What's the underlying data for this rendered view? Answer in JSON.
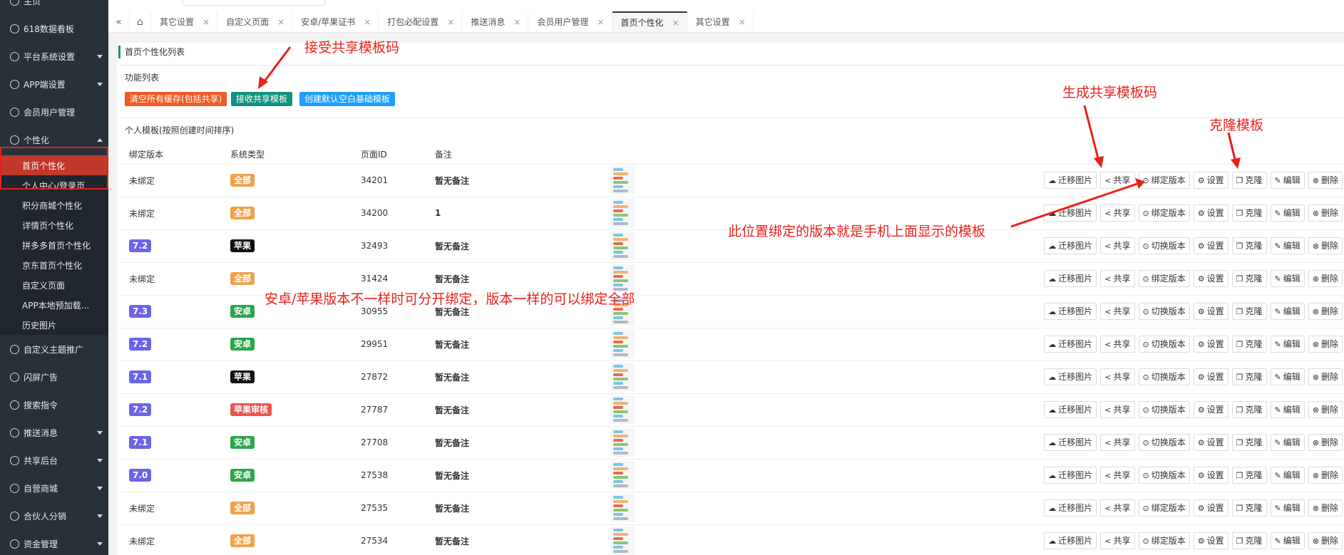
{
  "sidebar": {
    "items": [
      {
        "label": "主页",
        "icon": "home-icon"
      },
      {
        "label": "618数据看板",
        "icon": "dashboard-icon"
      },
      {
        "label": "平台系统设置",
        "icon": "settings-icon",
        "caret": true
      },
      {
        "label": "APP端设置",
        "icon": "gear-icon",
        "caret": true
      },
      {
        "label": "会员用户管理",
        "icon": "shield-icon"
      },
      {
        "label": "个性化",
        "icon": "palette-icon",
        "caret": "up"
      }
    ],
    "subitems": [
      {
        "label": "首页个性化",
        "active": true
      },
      {
        "label": "个人中心/登录页"
      },
      {
        "label": "积分商城个性化"
      },
      {
        "label": "详情页个性化"
      },
      {
        "label": "拼多多首页个性化"
      },
      {
        "label": "京东首页个性化"
      },
      {
        "label": "自定义页面"
      },
      {
        "label": "APP本地预加载..."
      },
      {
        "label": "历史图片"
      }
    ],
    "items2": [
      {
        "label": "自定义主题推广",
        "icon": "gear-icon"
      },
      {
        "label": "闪屏广告",
        "icon": "image-icon"
      },
      {
        "label": "搜索指令",
        "icon": "search-icon"
      },
      {
        "label": "推送消息",
        "icon": "user-icon",
        "caret": true
      },
      {
        "label": "共享后台",
        "icon": "user-icon",
        "caret": true
      },
      {
        "label": "自营商城",
        "icon": "shop-icon",
        "caret": true
      },
      {
        "label": "合伙人分销",
        "icon": "layers-icon",
        "caret": true
      },
      {
        "label": "资金管理",
        "icon": "link-icon",
        "caret": true
      }
    ]
  },
  "tabs": [
    {
      "label": "其它设置"
    },
    {
      "label": "自定义页面"
    },
    {
      "label": "安卓/苹果证书"
    },
    {
      "label": "打包必配设置"
    },
    {
      "label": "推送消息"
    },
    {
      "label": "会员用户管理"
    },
    {
      "label": "首页个性化",
      "active": true
    },
    {
      "label": "其它设置"
    }
  ],
  "section_title": "首页个性化列表",
  "function_list_label": "功能列表",
  "buttons": {
    "clear_cache": "清空所有缓存(包括共享)",
    "receive_share": "接收共享模板",
    "create_default": "创建默认空白基础模板"
  },
  "personal_label": "个人模板(按照创建时间排序)",
  "table": {
    "headers": [
      "绑定版本",
      "系统类型",
      "页面ID",
      "备注"
    ],
    "rows": [
      {
        "version": "未绑定",
        "system": "全部",
        "sys_color": "#f0a24a",
        "id": "34201",
        "note": "暂无备注",
        "switch": "绑定版本"
      },
      {
        "version": "未绑定",
        "system": "全部",
        "sys_color": "#f0a24a",
        "id": "34200",
        "note": "1",
        "switch": "绑定版本"
      },
      {
        "version": "7.2",
        "system": "苹果",
        "sys_color": "#111111",
        "id": "32493",
        "note": "暂无备注",
        "switch": "切换版本"
      },
      {
        "version": "未绑定",
        "system": "全部",
        "sys_color": "#f0a24a",
        "id": "31424",
        "note": "暂无备注",
        "switch": "绑定版本"
      },
      {
        "version": "7.3",
        "system": "安卓",
        "sys_color": "#2aa64a",
        "id": "30955",
        "note": "暂无备注",
        "switch": "切换版本"
      },
      {
        "version": "7.2",
        "system": "安卓",
        "sys_color": "#2aa64a",
        "id": "29951",
        "note": "暂无备注",
        "switch": "切换版本"
      },
      {
        "version": "7.1",
        "system": "苹果",
        "sys_color": "#111111",
        "id": "27872",
        "note": "暂无备注",
        "switch": "切换版本"
      },
      {
        "version": "7.2",
        "system": "苹果审核",
        "sys_color": "#ef5350",
        "id": "27787",
        "note": "暂无备注",
        "switch": "切换版本"
      },
      {
        "version": "7.1",
        "system": "安卓",
        "sys_color": "#2aa64a",
        "id": "27708",
        "note": "暂无备注",
        "switch": "切换版本"
      },
      {
        "version": "7.0",
        "system": "安卓",
        "sys_color": "#2aa64a",
        "id": "27538",
        "note": "暂无备注",
        "switch": "切换版本"
      },
      {
        "version": "未绑定",
        "system": "全部",
        "sys_color": "#f0a24a",
        "id": "27535",
        "note": "暂无备注",
        "switch": "绑定版本"
      },
      {
        "version": "未绑定",
        "system": "全部",
        "sys_color": "#f0a24a",
        "id": "27534",
        "note": "暂无备注",
        "switch": "绑定版本"
      }
    ],
    "actions": {
      "migrate": "迁移图片",
      "share": "共享",
      "settings": "设置",
      "clone": "克隆",
      "edit": "编辑",
      "delete": "删除"
    }
  },
  "annotations": {
    "receive_code": "接受共享模板码",
    "generate_code": "生成共享模板码",
    "clone_template": "克隆模板",
    "bound_version": "此位置绑定的版本就是手机上面显示的模板",
    "android_apple": "安卓/苹果版本不一样时可分开绑定，版本一样的可以绑定全部"
  }
}
